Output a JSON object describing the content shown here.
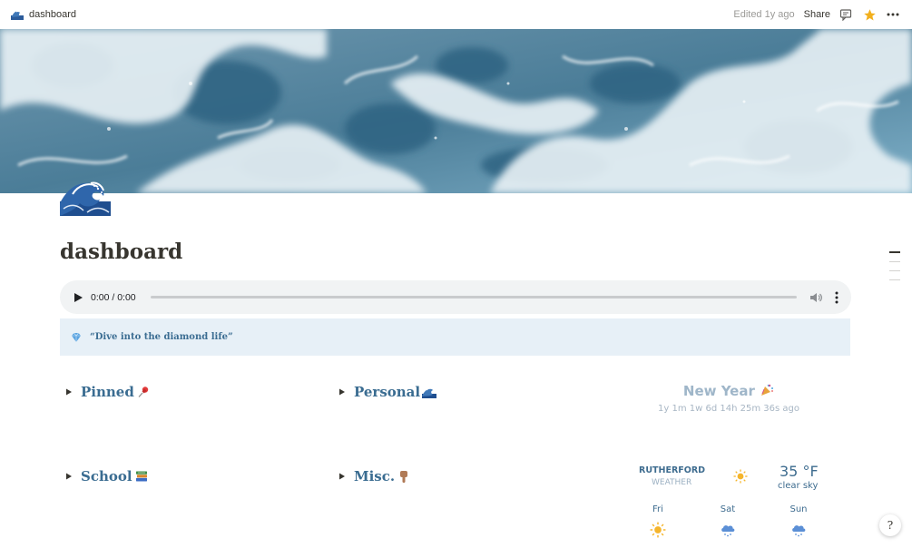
{
  "topbar": {
    "breadcrumb_title": "dashboard",
    "edited": "Edited 1y ago",
    "share": "Share",
    "icons": [
      "wave-icon",
      "comment-icon",
      "star-icon",
      "more-icon"
    ]
  },
  "page": {
    "title": "dashboard",
    "icon": "great-wave-icon"
  },
  "audio": {
    "time": "0:00 / 0:00",
    "progress": 0
  },
  "callout": {
    "icon": "diamond-icon",
    "text": "“Dive into the diamond life”"
  },
  "toggles": [
    {
      "label": "Pinned",
      "emoji": "pushpin-icon"
    },
    {
      "label": "Personal",
      "emoji": "wave-icon"
    },
    {
      "label": "School",
      "emoji": "books-icon"
    },
    {
      "label": "Misc.",
      "emoji": "pointing-hand-icon"
    }
  ],
  "countdown": {
    "title": "New Year",
    "emoji": "party-popper-icon",
    "elapsed": "1y 1m 1w 6d 14h 25m 36s ago"
  },
  "weather": {
    "city": "RUTHERFORD",
    "subtitle": "WEATHER",
    "temp": "35 °F",
    "condition": "clear sky",
    "current_icon": "sun-icon",
    "forecast": [
      {
        "day": "Fri",
        "icon": "sun-icon"
      },
      {
        "day": "Sat",
        "icon": "snow-cloud-icon"
      },
      {
        "day": "Sun",
        "icon": "snow-cloud-icon"
      }
    ]
  },
  "help": {
    "label": "?"
  },
  "colors": {
    "accent_blue": "#3a6c91",
    "callout_bg": "#e7f0f7",
    "star": "#f2b01e",
    "ny_title": "#9fb6c9"
  }
}
